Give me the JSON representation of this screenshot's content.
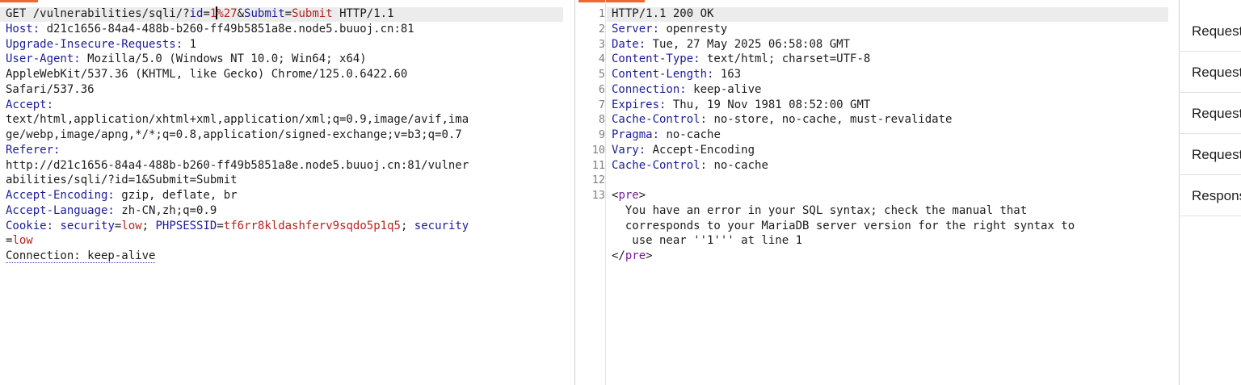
{
  "request": {
    "lines": [
      {
        "segs": [
          [
            "",
            "GET /vulnerabilities/sqli/?"
          ],
          [
            "k",
            "id"
          ],
          [
            "",
            "="
          ],
          [
            "pv",
            "1"
          ],
          [
            "caret",
            ""
          ],
          [
            "pv",
            "%27"
          ],
          [
            "",
            "&"
          ],
          [
            "k",
            "Submit"
          ],
          [
            "",
            "="
          ],
          [
            "pv",
            "Submit"
          ],
          [
            "",
            " HTTP/1.1"
          ]
        ]
      },
      {
        "segs": [
          [
            "k",
            "Host:"
          ],
          [
            "",
            " d21c1656-84a4-488b-b260-ff49b5851a8e.node5.buuoj.cn:81"
          ]
        ]
      },
      {
        "segs": [
          [
            "k",
            "Upgrade-Insecure-Requests:"
          ],
          [
            "",
            " 1"
          ]
        ]
      },
      {
        "segs": [
          [
            "k",
            "User-Agent:"
          ],
          [
            "",
            " Mozilla/5.0 (Windows NT 10.0; Win64; x64)"
          ]
        ]
      },
      {
        "segs": [
          [
            "",
            "AppleWebKit/537.36 (KHTML, like Gecko) Chrome/125.0.6422.60"
          ]
        ]
      },
      {
        "segs": [
          [
            "",
            "Safari/537.36"
          ]
        ]
      },
      {
        "segs": [
          [
            "k",
            "Accept:"
          ]
        ]
      },
      {
        "segs": [
          [
            "",
            "text/html,application/xhtml+xml,application/xml;q=0.9,image/avif,ima"
          ]
        ]
      },
      {
        "segs": [
          [
            "",
            "ge/webp,image/apng,*/*;q=0.8,application/signed-exchange;v=b3;q=0.7"
          ]
        ]
      },
      {
        "segs": [
          [
            "k",
            "Referer:"
          ]
        ]
      },
      {
        "segs": [
          [
            "",
            "http://d21c1656-84a4-488b-b260-ff49b5851a8e.node5.buuoj.cn:81/vulner"
          ]
        ]
      },
      {
        "segs": [
          [
            "",
            "abilities/sqli/?id=1&Submit=Submit"
          ]
        ]
      },
      {
        "segs": [
          [
            "k",
            "Accept-Encoding:"
          ],
          [
            "",
            " gzip, deflate, br"
          ]
        ]
      },
      {
        "segs": [
          [
            "k",
            "Accept-Language:"
          ],
          [
            "",
            " zh-CN,zh;q=0.9"
          ]
        ]
      },
      {
        "segs": [
          [
            "k",
            "Cookie:"
          ],
          [
            "",
            " "
          ],
          [
            "k",
            "security"
          ],
          [
            "",
            "="
          ],
          [
            "pv",
            "low"
          ],
          [
            "",
            "; "
          ],
          [
            "k",
            "PHPSESSID"
          ],
          [
            "",
            "="
          ],
          [
            "pv",
            "tf6rr8kldashferv9sqdo5p1q5"
          ],
          [
            "",
            "; "
          ],
          [
            "k",
            "security"
          ]
        ]
      },
      {
        "segs": [
          [
            "",
            "="
          ],
          [
            "pv",
            "low"
          ]
        ]
      },
      {
        "segs": [
          [
            "ul",
            "Connection: keep-alive"
          ]
        ]
      }
    ]
  },
  "response": {
    "line_numbers": [
      "1",
      "2",
      "3",
      "4",
      "5",
      "6",
      "7",
      "8",
      "9",
      "10",
      "11",
      "12",
      "13"
    ],
    "lines": [
      {
        "segs": [
          [
            "",
            "HTTP/1.1 200 OK"
          ]
        ]
      },
      {
        "segs": [
          [
            "k",
            "Server:"
          ],
          [
            "",
            " openresty"
          ]
        ]
      },
      {
        "segs": [
          [
            "k",
            "Date:"
          ],
          [
            "",
            " Tue, 27 May 2025 06:58:08 GMT"
          ]
        ]
      },
      {
        "segs": [
          [
            "k",
            "Content-Type:"
          ],
          [
            "",
            " text/html; charset=UTF-8"
          ]
        ]
      },
      {
        "segs": [
          [
            "k",
            "Content-Length:"
          ],
          [
            "",
            " 163"
          ]
        ]
      },
      {
        "segs": [
          [
            "k",
            "Connection:"
          ],
          [
            "",
            " keep-alive"
          ]
        ]
      },
      {
        "segs": [
          [
            "k",
            "Expires:"
          ],
          [
            "",
            " Thu, 19 Nov 1981 08:52:00 GMT"
          ]
        ]
      },
      {
        "segs": [
          [
            "k",
            "Cache-Control:"
          ],
          [
            "",
            " no-store, no-cache, must-revalidate"
          ]
        ]
      },
      {
        "segs": [
          [
            "k",
            "Pragma:"
          ],
          [
            "",
            " no-cache"
          ]
        ]
      },
      {
        "segs": [
          [
            "k",
            "Vary:"
          ],
          [
            "",
            " Accept-Encoding"
          ]
        ]
      },
      {
        "segs": [
          [
            "k",
            "Cache-Control:"
          ],
          [
            "",
            " no-cache"
          ]
        ]
      },
      {
        "segs": [
          [
            "",
            ""
          ]
        ]
      },
      {
        "segs": [
          [
            "",
            "<"
          ],
          [
            "tag",
            "pre"
          ],
          [
            "",
            ">"
          ]
        ]
      },
      {
        "segs": [
          [
            "",
            "  You have an error in your SQL syntax; check the manual that"
          ]
        ]
      },
      {
        "segs": [
          [
            "",
            "  corresponds to your MariaDB server version for the right syntax to"
          ]
        ]
      },
      {
        "segs": [
          [
            "",
            "   use near ''1''' at line 1"
          ]
        ]
      },
      {
        "segs": [
          [
            "",
            "</"
          ],
          [
            "tag",
            "pre"
          ],
          [
            "",
            ">"
          ]
        ]
      }
    ]
  },
  "side_panel": {
    "items": [
      "Request",
      "Request",
      "Request",
      "Request",
      "Response"
    ]
  },
  "colors": {
    "accent": "#f0672f",
    "header_name": "#1c1c99",
    "param_value": "#b3261e",
    "tag": "#7a1c9c"
  }
}
